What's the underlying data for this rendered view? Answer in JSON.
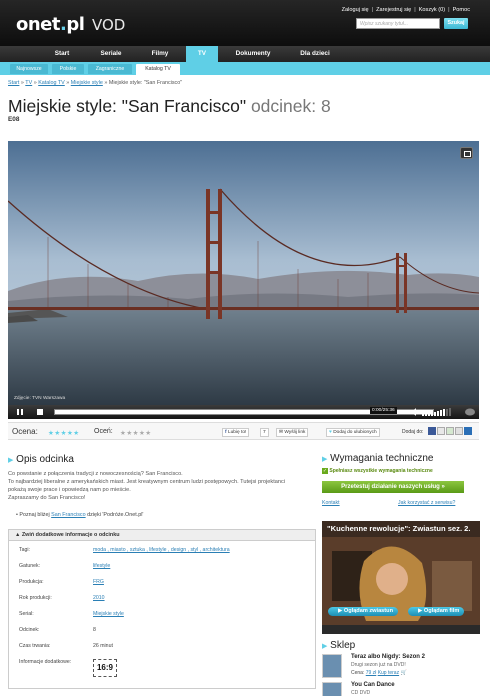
{
  "header": {
    "logo_main": "onet",
    "logo_dot": ".",
    "logo_tld": "pl",
    "logo_vod": "VOD",
    "links": [
      "Zaloguj się",
      "|",
      "Zarejestruj się",
      "|",
      "Koszyk (0)",
      "|",
      "Pomoc"
    ],
    "search_placeholder": "Wpisz szukany tytuł...",
    "search_button": "Szukaj"
  },
  "nav": {
    "tabs": [
      "Start",
      "Seriale",
      "Filmy",
      "TV",
      "Dokumenty",
      "Dla dzieci"
    ],
    "active": "TV",
    "subtabs": [
      "Najnowsze",
      "Polskie",
      "Zagraniczne",
      "Katalog TV"
    ],
    "active_sub": "Katalog TV"
  },
  "breadcrumb": {
    "items": [
      "Start",
      "TV",
      "Katalog TV",
      "Miejskie style"
    ],
    "current": "Miejskie style: \"San Francisco\"",
    "sep": "»"
  },
  "page": {
    "title": "Miejskie style: \"San Francisco\"",
    "episode": "odcinek: 8",
    "code": "E08"
  },
  "player": {
    "credit": "Zdjęcie: TVN Warszawa",
    "time": "0:00/25:36",
    "progress": 0.0
  },
  "rating": {
    "label1": "Ocena:",
    "label2": "Oceń:",
    "stars1": "★★★★★",
    "stars2": "★★★★★",
    "like": "Lubię to!",
    "like_count": "7",
    "wykop": "Wyślij link",
    "fav": "Dodaj do ulubionych",
    "add_to": "Dodaj do:"
  },
  "description": {
    "heading": "Opis odcinka",
    "lines": [
      "Co powstanie z połączenia tradycji z nowoczesnością? San Francisco.",
      "To najbardziej liberalne z amerykańskich miast. Jest kreatywnym centrum ludzi postępowych. Tutejsi projektanci",
      "pokażą swoje prace i opowiedzą nam po mieście.",
      "Zapraszamy do San Francisco!"
    ],
    "bullet_pre": "Poznaj bliżej ",
    "bullet_link": "San Francisco",
    "bullet_post": " dzięki 'Podróże.Onet.pl'"
  },
  "info": {
    "toggle": "Zwiń dodatkowe informacje o odcinku",
    "rows": [
      {
        "k": "Tagi:",
        "v": "moda , miasto , sztuka , lifestyle , design , styl , architektura"
      },
      {
        "k": "Gatunek:",
        "v": "lifestyle"
      },
      {
        "k": "Produkcja:",
        "v": "FRG"
      },
      {
        "k": "Rok produkcji:",
        "v": "2010"
      },
      {
        "k": "Serial:",
        "v": "Miejskie style"
      },
      {
        "k": "Odcinek:",
        "v": "8"
      },
      {
        "k": "Czas trwania:",
        "v": "26 minut"
      },
      {
        "k": "Informacje dodatkowe:",
        "v": ""
      }
    ],
    "aspect": "16:9"
  },
  "sidebar": {
    "req_heading": "Wymagania techniczne",
    "req_ok": "Spełniasz wszystkie wymagania techniczne",
    "test_button": "Przetestuj działanie naszych usług »",
    "contact": "Kontakt",
    "how": "Jak korzystać z serwisu?",
    "trailer_title": "\"Kuchenne rewolucje\": Zwiastun sez. 2.",
    "watch_trailer": "Oglądam zwiastun",
    "watch_film": "Oglądam film",
    "shop_heading": "Sklep",
    "shop": [
      {
        "name": "Teraz albo Nigdy: Sezon 2",
        "sub": "Drugi sezon już na DVD!",
        "price_lbl": "Cena:",
        "price": "79 zł",
        "buy": "Kup teraz"
      },
      {
        "name": "You Can Dance",
        "sub": "CD DVD",
        "price_lbl": "",
        "price": "",
        "buy": ""
      }
    ]
  },
  "colors": {
    "accent": "#5fcfe6",
    "green": "#6aaa1c",
    "link": "#2a7fb5"
  }
}
